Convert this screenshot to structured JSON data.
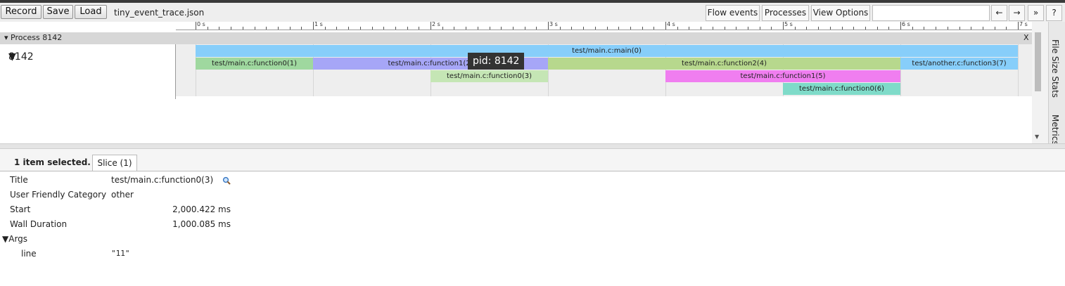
{
  "toolbar": {
    "record_label": "Record",
    "save_label": "Save",
    "load_label": "Load",
    "filename": "tiny_event_trace.json",
    "flow_events_label": "Flow events",
    "processes_label": "Processes",
    "view_options_label": "View Options",
    "search_value": "",
    "prev_label": "←",
    "next_label": "→",
    "more_label": "»",
    "help_label": "?"
  },
  "ruler": {
    "labels": [
      "0 s",
      "1 s",
      "2 s",
      "3 s",
      "4 s",
      "5 s",
      "6 s",
      "7 s"
    ]
  },
  "process": {
    "title": "Process 8142",
    "close_label": "X",
    "thread_label": "8142",
    "expand_glyph": "▼"
  },
  "slices": {
    "main": "test/main.c:main(0)",
    "f0_1": "test/main.c:function0(1)",
    "f1_2": "test/main.c:function1(2)",
    "f2_4": "test/main.c:function2(4)",
    "f3_7": "test/another.c:function3(7)",
    "f0_3": "test/main.c:function0(3)",
    "f1_5": "test/main.c:function1(5)",
    "f0_6": "test/main.c:function0(6)"
  },
  "slice_colors": {
    "main": "#87cefa",
    "f0_1": "#9fd89f",
    "f1_2": "#a6a6f7",
    "f2_4": "#b7d88d",
    "f3_7": "#87cefa",
    "f0_3": "#c5e6b5",
    "f1_5": "#f07ef0",
    "f0_6": "#7fdbc9"
  },
  "tooltip": {
    "text": "pid: 8142"
  },
  "side_tabs": {
    "file_size_stats": "File Size Stats",
    "metrics": "Metrics"
  },
  "analysis": {
    "selection_count": "1 item selected.",
    "tab_label": "Slice (1)",
    "rows": {
      "title_key": "Title",
      "title_value": "test/main.c:function0(3)",
      "category_key": "User Friendly Category",
      "category_value": "other",
      "start_key": "Start",
      "start_value": "2,000.422 ms",
      "duration_key": "Wall Duration",
      "duration_value": "1,000.085 ms",
      "args_key": "Args",
      "line_key": "line",
      "line_value": "\"11\""
    }
  }
}
